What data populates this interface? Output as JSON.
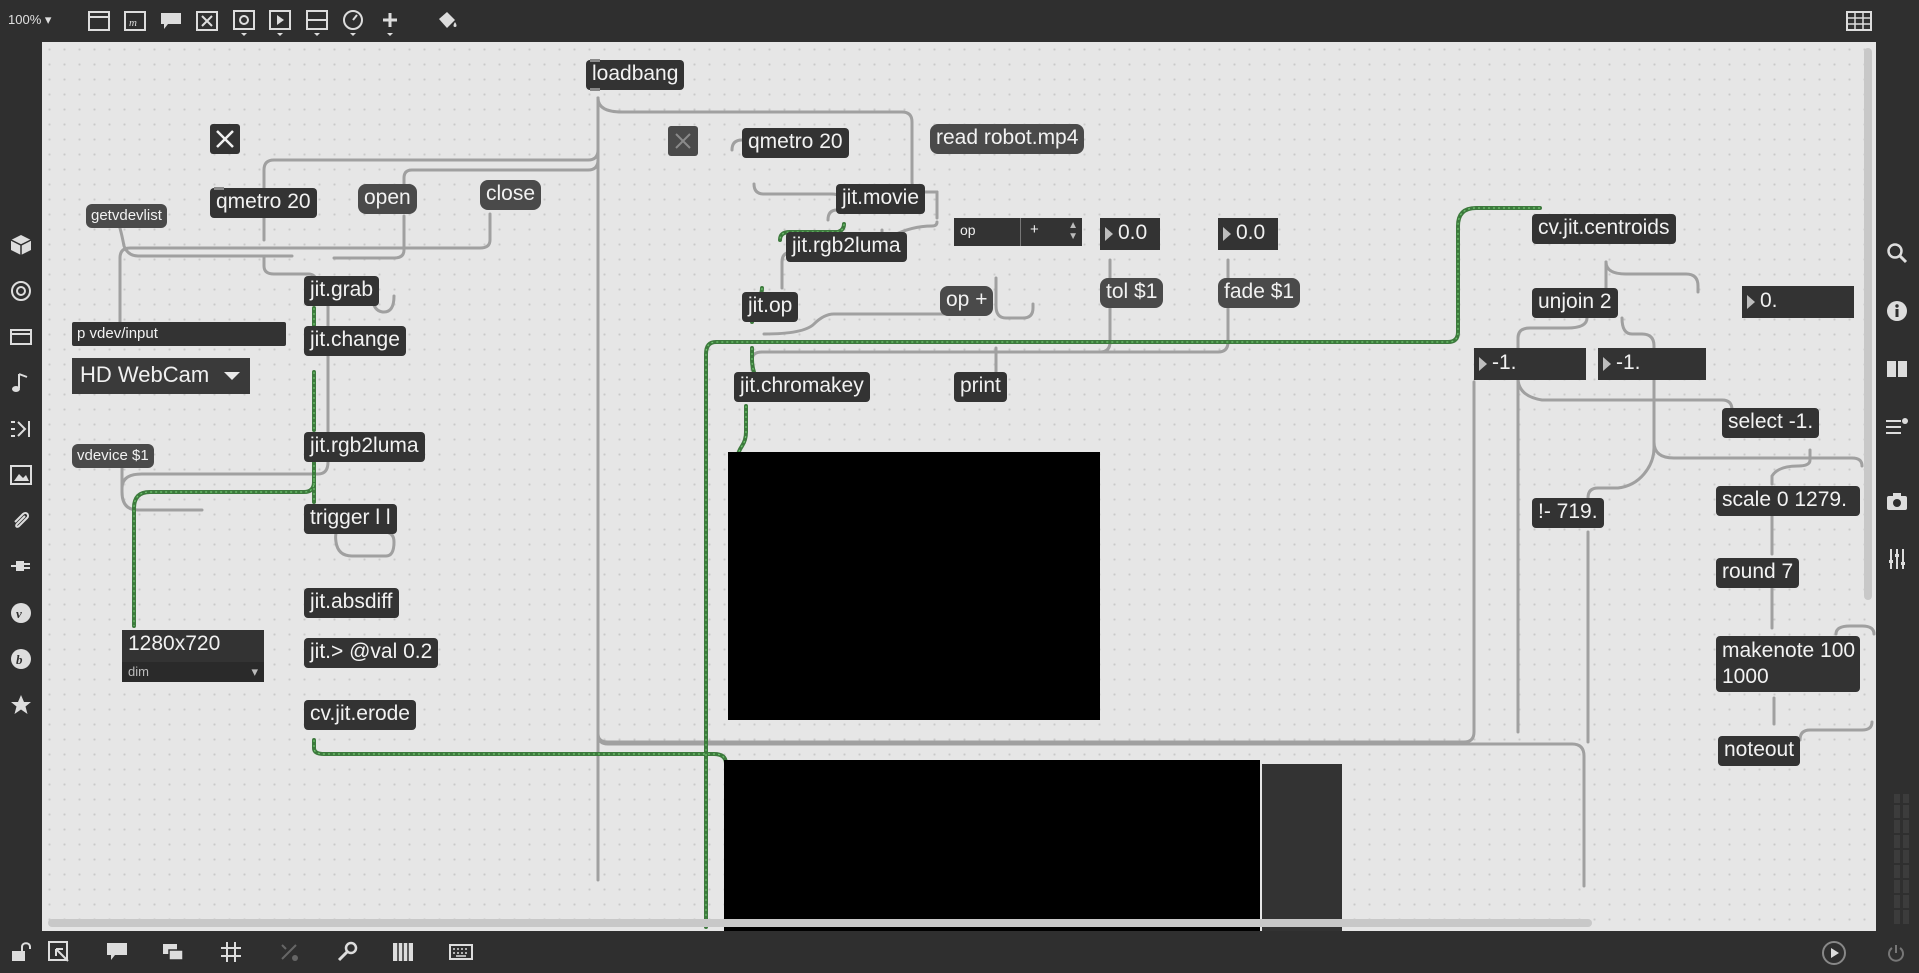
{
  "toolbar": {
    "zoom": "100%",
    "icons": [
      "presentation-icon",
      "comment-icon",
      "message-icon",
      "toggle-icon",
      "button-icon",
      "inlet-icon",
      "slider-icon",
      "dial-icon",
      "add-icon",
      "paint-bucket-icon"
    ],
    "right_icon": "grid-list-icon"
  },
  "left_sidebar": {
    "icons": [
      "cube-icon",
      "target-icon",
      "film-icon",
      "music-note-icon",
      "sequence-icon",
      "image-icon",
      "paperclip-icon",
      "plug-icon",
      "v-icon",
      "b-icon",
      "star-icon"
    ]
  },
  "right_sidebar": {
    "icons": [
      "search-icon",
      "info-icon",
      "book-icon",
      "list-icon",
      "camera-icon",
      "sliders-icon"
    ]
  },
  "bottom_toolbar": {
    "icons": [
      "lock-icon",
      "edit-icon",
      "comment-icon",
      "window-icon",
      "grid-icon",
      "snap-icon",
      "wrench-icon",
      "piano-icon",
      "keyboard-icon",
      "play-icon"
    ]
  },
  "patch": {
    "loadbang": "loadbang",
    "qmetro_left": "qmetro 20",
    "open": "open",
    "close": "close",
    "getvdevlist": "getvdevlist",
    "p_vdev_input": "p vdev/input",
    "webcam_menu": "HD WebCam",
    "vdevice": "vdevice $1",
    "jit_grab": "jit.grab",
    "jit_change": "jit.change",
    "jit_rgb2luma_left": "jit.rgb2luma",
    "trigger": "trigger l l",
    "jit_absdiff": "jit.absdiff",
    "jit_gt": "jit.> @val 0.2",
    "cv_erode": "cv.jit.erode",
    "dim_value": "1280x720",
    "dim_label": "dim",
    "qmetro_mid": "qmetro 20",
    "read_msg": "read robot.mp4",
    "jit_movie": "jit.movie",
    "jit_rgb2luma_mid": "jit.rgb2luma",
    "jit_op": "jit.op",
    "jit_chromakey": "jit.chromakey",
    "attr_name": "op",
    "attr_value": "+",
    "op_msg": "op +",
    "print": "print",
    "num_tol": "0.0",
    "tol_msg": "tol $1",
    "num_fade": "0.0",
    "fade_msg": "fade $1",
    "cv_centroids": "cv.jit.centroids",
    "unjoin": "unjoin 2",
    "num_right": "0.",
    "num_a": "-1.",
    "num_b": "-1.",
    "select": "select -1.",
    "scale": "scale 0 1279.",
    "not_minus": "!- 719.",
    "round": "round 7",
    "makenote_1": "makenote 100",
    "makenote_2": "1000",
    "noteout": "noteout"
  }
}
